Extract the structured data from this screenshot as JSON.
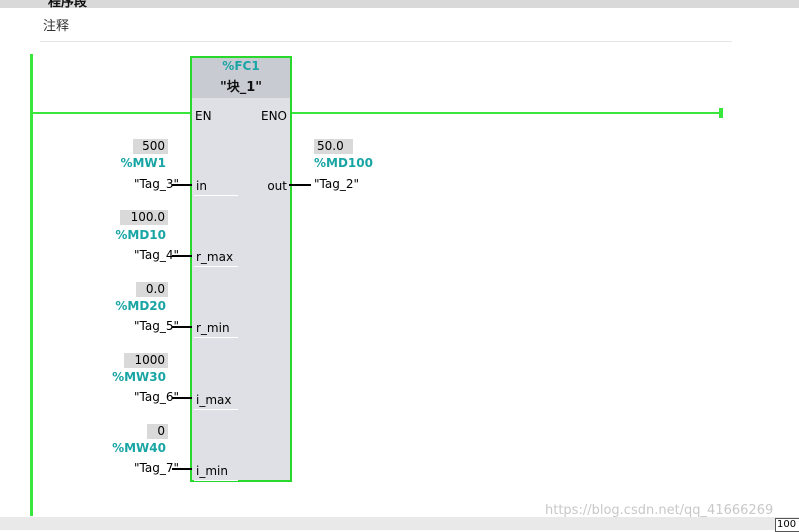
{
  "header": {
    "title": "程序段"
  },
  "comment": {
    "label": "注释"
  },
  "block": {
    "address": "%FC1",
    "name": "\"块_1\""
  },
  "pins": {
    "en": "EN",
    "eno": "ENO",
    "out": "out",
    "in": "in",
    "r_max": "r_max",
    "r_min": "r_min",
    "i_max": "i_max",
    "i_min": "i_min"
  },
  "inputs": [
    {
      "value": "500",
      "operand": "%MW1",
      "tag": "\"Tag_3\""
    },
    {
      "value": "100.0",
      "operand": "%MD10",
      "tag": "\"Tag_4\""
    },
    {
      "value": "0.0",
      "operand": "%MD20",
      "tag": "\"Tag_5\""
    },
    {
      "value": "1000",
      "operand": "%MW30",
      "tag": "\"Tag_6\""
    },
    {
      "value": "0",
      "operand": "%MW40",
      "tag": "\"Tag_7\""
    }
  ],
  "output": {
    "value": "50.0",
    "operand": "%MD100",
    "tag": "\"Tag_2\""
  },
  "watermark": "https://blog.csdn.net/qq_41666269",
  "zoom": "100"
}
